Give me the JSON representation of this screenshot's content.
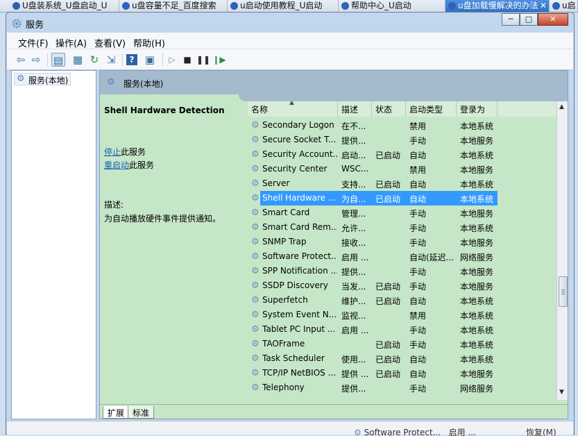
{
  "browser_tabs": [
    {
      "label": "U盘装系统_U盘启动_U"
    },
    {
      "label": "u盘容量不足_百度搜索"
    },
    {
      "label": "u启动使用教程_U启动"
    },
    {
      "label": "帮助中心_U启动"
    },
    {
      "label": "u盘加载慢解决的办法"
    },
    {
      "label": "u启"
    }
  ],
  "window": {
    "title": "服务",
    "min_glyph": "─",
    "max_glyph": "□",
    "close_glyph": "✕"
  },
  "menu": {
    "file": "文件(F)",
    "action": "操作(A)",
    "view": "查看(V)",
    "help": "帮助(H)"
  },
  "tree": {
    "item": "服务(本地)"
  },
  "panel": {
    "header": "服务(本地)",
    "service_title": "Shell Hardware Detection",
    "stop_link": "停止",
    "stop_suffix": "此服务",
    "restart_link": "重启动",
    "restart_suffix": "此服务",
    "desc_label": "描述:",
    "desc_text": "为自动播放硬件事件提供通知。"
  },
  "columns": {
    "name": "名称",
    "desc": "描述",
    "status": "状态",
    "startup": "启动类型",
    "logon": "登录为"
  },
  "services": [
    {
      "name": "Secondary Logon",
      "desc": "在不...",
      "status": "",
      "startup": "禁用",
      "logon": "本地系统"
    },
    {
      "name": "Secure Socket T...",
      "desc": "提供...",
      "status": "",
      "startup": "手动",
      "logon": "本地服务"
    },
    {
      "name": "Security Account...",
      "desc": "启动...",
      "status": "已启动",
      "startup": "自动",
      "logon": "本地系统"
    },
    {
      "name": "Security Center",
      "desc": "WSC...",
      "status": "",
      "startup": "禁用",
      "logon": "本地服务"
    },
    {
      "name": "Server",
      "desc": "支持...",
      "status": "已启动",
      "startup": "自动",
      "logon": "本地系统"
    },
    {
      "name": "Shell Hardware ...",
      "desc": "为自...",
      "status": "已启动",
      "startup": "自动",
      "logon": "本地系统",
      "selected": true
    },
    {
      "name": "Smart Card",
      "desc": "管理...",
      "status": "",
      "startup": "手动",
      "logon": "本地服务"
    },
    {
      "name": "Smart Card Rem...",
      "desc": "允许...",
      "status": "",
      "startup": "手动",
      "logon": "本地系统"
    },
    {
      "name": "SNMP Trap",
      "desc": "接收...",
      "status": "",
      "startup": "手动",
      "logon": "本地服务"
    },
    {
      "name": "Software Protect...",
      "desc": "启用 ...",
      "status": "",
      "startup": "自动(延迟...",
      "logon": "网络服务"
    },
    {
      "name": "SPP Notification ...",
      "desc": "提供...",
      "status": "",
      "startup": "手动",
      "logon": "本地服务"
    },
    {
      "name": "SSDP Discovery",
      "desc": "当发...",
      "status": "已启动",
      "startup": "手动",
      "logon": "本地服务"
    },
    {
      "name": "Superfetch",
      "desc": "维护...",
      "status": "已启动",
      "startup": "自动",
      "logon": "本地系统"
    },
    {
      "name": "System Event N...",
      "desc": "监视...",
      "status": "",
      "startup": "禁用",
      "logon": "本地系统"
    },
    {
      "name": "Tablet PC Input ...",
      "desc": "启用 ...",
      "status": "",
      "startup": "手动",
      "logon": "本地系统"
    },
    {
      "name": "TAOFrame",
      "desc": "",
      "status": "已启动",
      "startup": "手动",
      "logon": "本地系统"
    },
    {
      "name": "Task Scheduler",
      "desc": "使用...",
      "status": "已启动",
      "startup": "自动",
      "logon": "本地系统"
    },
    {
      "name": "TCP/IP NetBIOS ...",
      "desc": "提供 ...",
      "status": "已启动",
      "startup": "自动",
      "logon": "本地服务"
    },
    {
      "name": "Telephony",
      "desc": "提供...",
      "status": "",
      "startup": "手动",
      "logon": "网络服务"
    }
  ],
  "bottom_tabs": {
    "extended": "扩展",
    "standard": "标准"
  },
  "behind_text": {
    "name": "Software Protect...",
    "desc": "启用 ...",
    "restore": "恢复(M)"
  },
  "colors": {
    "pane_bg": "#c6e6c8",
    "selection": "#3399ff",
    "link": "#1d5fb0",
    "header_bar": "#a4bacd"
  }
}
